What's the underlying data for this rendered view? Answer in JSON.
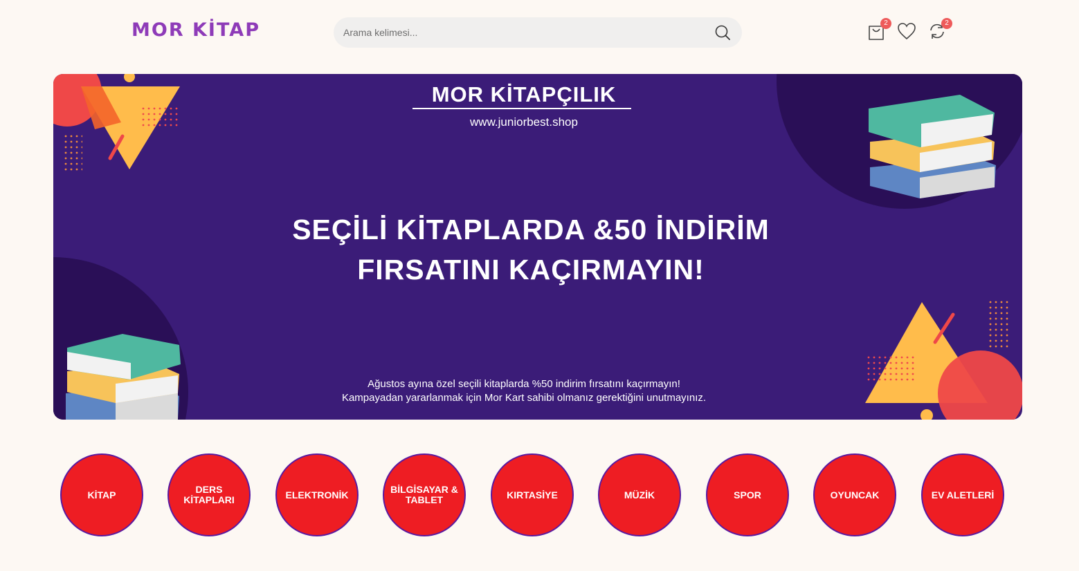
{
  "header": {
    "logo": "MOR KİTAP",
    "search": {
      "placeholder": "Arama kelimesi..."
    },
    "cart_count": "2",
    "compare_count": "2"
  },
  "banner": {
    "brand": "MOR KİTAPÇILIK",
    "url": "www.juniorbest.shop",
    "headline_line1": "SEÇİLİ KİTAPLARDA &50 İNDİRİM",
    "headline_line2": "FIRSATINI KAÇIRMAYIN!",
    "sub_line1": "Ağustos ayına özel seçili kitaplarda %50 indirim fırsatını kaçırmayın!",
    "sub_line2": "Kampayadan yararlanmak için Mor Kart sahibi olmanız gerektiğini unutmayınız."
  },
  "categories": [
    {
      "label": "KİTAP"
    },
    {
      "label": "DERS KİTAPLARI"
    },
    {
      "label": "ELEKTRONİK"
    },
    {
      "label": "BİLGİSAYAR & TABLET"
    },
    {
      "label": "KIRTASİYE"
    },
    {
      "label": "MÜZİK"
    },
    {
      "label": "SPOR"
    },
    {
      "label": "OYUNCAK"
    },
    {
      "label": "EV ALETLERİ"
    }
  ],
  "colors": {
    "background": "#fdf8f3",
    "brand_purple": "#8e3bb8",
    "banner_purple": "#3b1c78",
    "category_red": "#ee1d23",
    "badge_red": "#ee5a5a"
  },
  "icons": [
    "search-icon",
    "cart-icon",
    "heart-icon",
    "compare-icon"
  ]
}
